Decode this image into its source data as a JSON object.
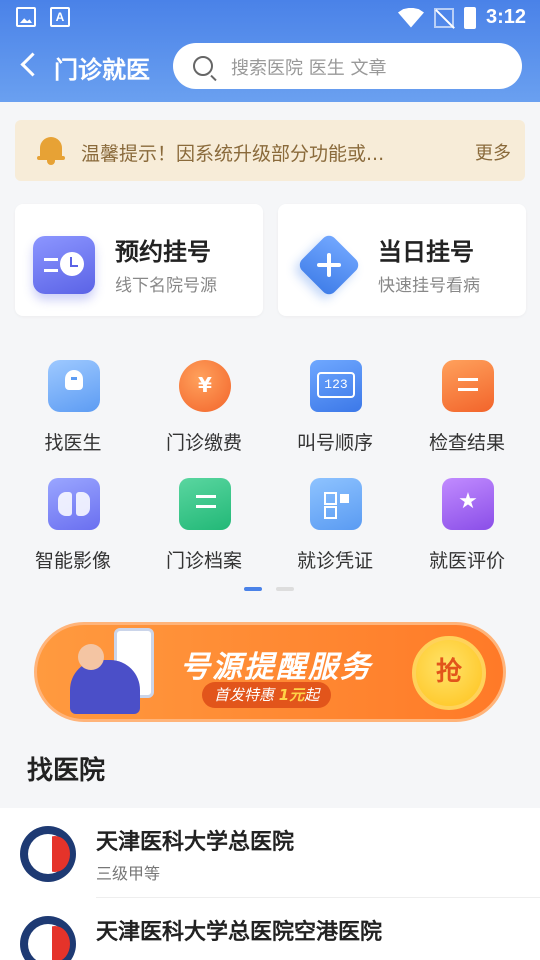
{
  "status_bar": {
    "time": "3:12",
    "a_icon_label": "A"
  },
  "nav": {
    "title": "门诊就医",
    "search_placeholder": "搜索医院 医生 文章"
  },
  "notice": {
    "text": "温馨提示！因系统升级部分功能或...",
    "more": "更多"
  },
  "cards": [
    {
      "title": "预约挂号",
      "subtitle": "线下名院号源",
      "icon": "calendar-clock-icon"
    },
    {
      "title": "当日挂号",
      "subtitle": "快速挂号看病",
      "icon": "plus-diamond-icon"
    }
  ],
  "grid": [
    {
      "label": "找医生",
      "icon": "doctor-icon"
    },
    {
      "label": "门诊缴费",
      "icon": "yuan-coin-icon",
      "glyph": "¥"
    },
    {
      "label": "叫号顺序",
      "icon": "queue-number-icon",
      "glyph": "123"
    },
    {
      "label": "检查结果",
      "icon": "report-icon"
    },
    {
      "label": "智能影像",
      "icon": "lung-image-icon"
    },
    {
      "label": "门诊档案",
      "icon": "record-icon"
    },
    {
      "label": "就诊凭证",
      "icon": "qr-code-icon"
    },
    {
      "label": "就医评价",
      "icon": "star-rating-icon"
    }
  ],
  "pager": {
    "pages": 2,
    "active": 1
  },
  "banner": {
    "title": "号源提醒服务",
    "sub_pre": "首发特惠",
    "sub_price": "1元",
    "sub_post": "起",
    "button": "抢"
  },
  "hospital_section": {
    "title": "找医院",
    "items": [
      {
        "name": "天津医科大学总医院",
        "level": "三级甲等"
      },
      {
        "name": "天津医科大学总医院空港医院",
        "level": ""
      }
    ]
  },
  "colors": {
    "primary": "#4a82e8",
    "accent_orange": "#ff7a28",
    "notice_bg": "#f7ecd8",
    "notice_text": "#8a6a3b"
  }
}
